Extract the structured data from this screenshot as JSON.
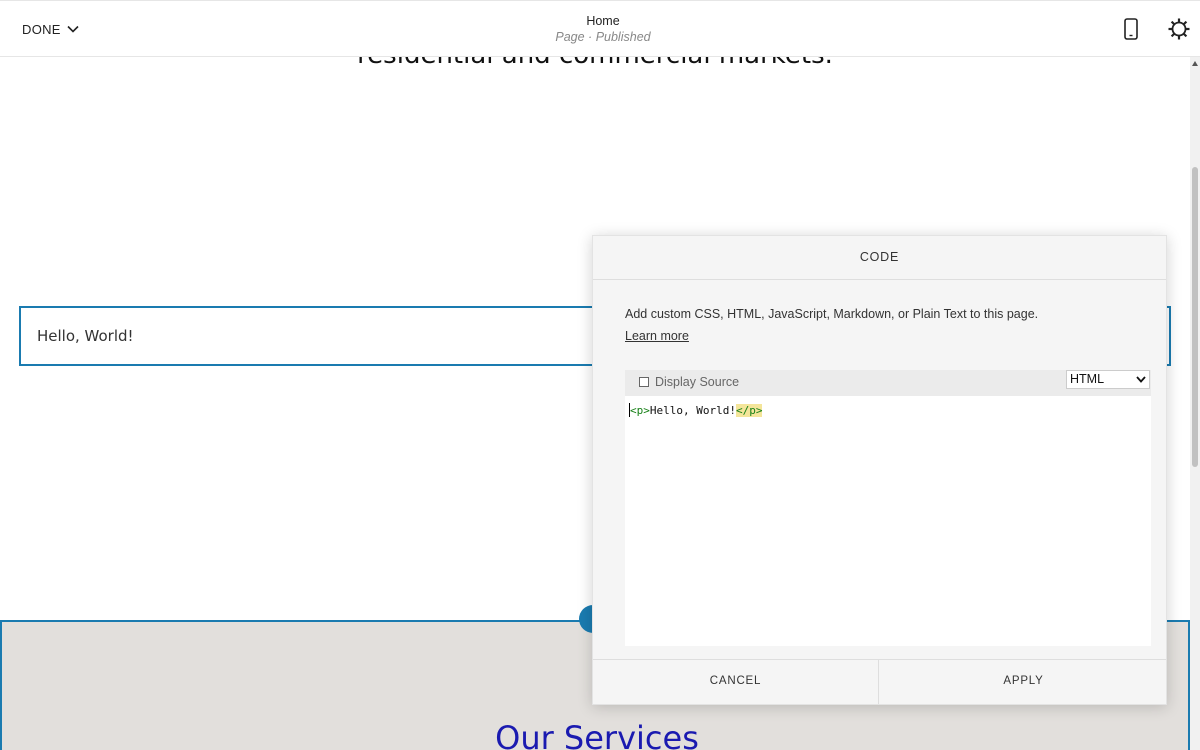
{
  "topbar": {
    "done_label": "DONE",
    "page_title": "Home",
    "page_status": "Page · Published",
    "mobile_icon": "mobile-preview-icon",
    "settings_icon": "gear-icon"
  },
  "canvas": {
    "headline": "residential and commercial markets.",
    "text_block": "Hello, World!",
    "services_heading": "Our Services"
  },
  "dialog": {
    "title": "CODE",
    "description": "Add custom CSS, HTML, JavaScript, Markdown, or Plain Text to this page.",
    "learn_more": "Learn more",
    "display_source_label": "Display Source",
    "display_source_checked": false,
    "mode": "HTML",
    "code": {
      "open_tag": "<p>",
      "content": "Hello, World!",
      "close_tag": "</p>"
    },
    "cancel_label": "CANCEL",
    "apply_label": "APPLY"
  },
  "colors": {
    "accent": "#1a7bb0",
    "services_bg": "#e2dfdc",
    "services_heading": "#1a1ab0"
  }
}
